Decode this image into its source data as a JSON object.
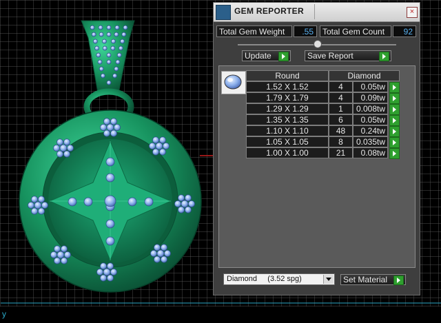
{
  "window": {
    "title": "GEM REPORTER",
    "close_label": "×"
  },
  "summary": {
    "total_gem_weight_label": "Total Gem Weight",
    "total_gem_weight_value": ".55",
    "total_gem_count_label": "Total Gem Count",
    "total_gem_count_value": "92"
  },
  "actions": {
    "update_label": "Update",
    "save_report_label": "Save Report"
  },
  "table": {
    "headers": [
      "Round",
      "Diamond"
    ],
    "rows": [
      {
        "size": "1.52 X 1.52",
        "count": "4",
        "weight": "0.05tw"
      },
      {
        "size": "1.79 X 1.79",
        "count": "4",
        "weight": "0.09tw"
      },
      {
        "size": "1.29 X 1.29",
        "count": "1",
        "weight": "0.008tw"
      },
      {
        "size": "1.35 X 1.35",
        "count": "6",
        "weight": "0.05tw"
      },
      {
        "size": "1.10 X 1.10",
        "count": "48",
        "weight": "0.24tw"
      },
      {
        "size": "1.05 X 1.05",
        "count": "8",
        "weight": "0.035tw"
      },
      {
        "size": "1.00 X 1.00",
        "count": "21",
        "weight": "0.08tw"
      }
    ]
  },
  "material": {
    "selected": "Diamond     (3.52 spg)",
    "set_label": "Set Material"
  },
  "viewport": {
    "axis_label": "y"
  },
  "colors": {
    "metal": "#1d9a6a",
    "gem": "#8ab2ec",
    "grid": "#5a5a5a"
  }
}
